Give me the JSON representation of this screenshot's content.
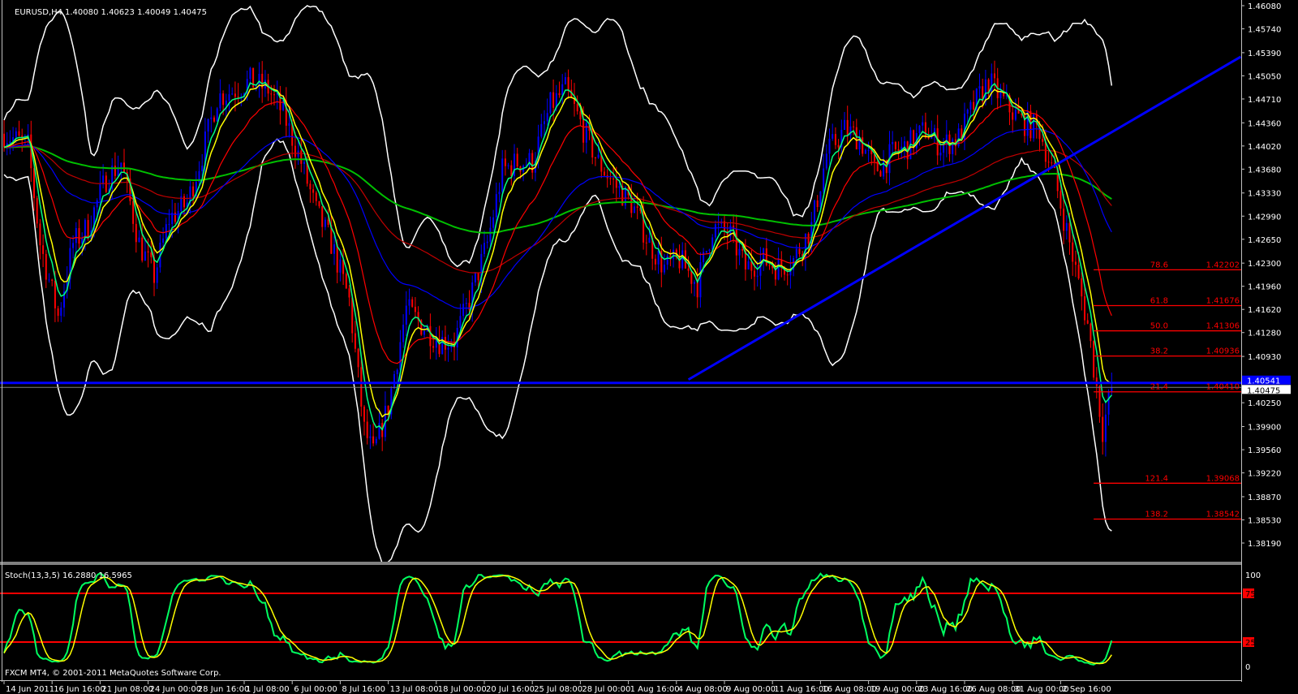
{
  "header": {
    "symbol": "EURUSD,H4",
    "ohlc": "1.40080 1.40623 1.40049 1.40475"
  },
  "stoch_label": "Stoch(13,3,5) 16.2880 16.5965",
  "copyright": "FXCM MT4, © 2001-2011 MetaQuotes Software Corp.",
  "colors": {
    "background": "#000000",
    "bull": "#0000ff",
    "bear": "#ff0000",
    "bands": "#ffffff",
    "ma_fast": "#00ff80",
    "ma_8": "#ffff00",
    "ma_21": "#ff0000",
    "ma_55": "#0000ff",
    "ma_100": "#c00000",
    "ma_200": "#00c000",
    "trendline": "#0000ff",
    "fib": "#ff0000",
    "stoch_main": "#00ff60",
    "stoch_signal": "#ffff00"
  },
  "chart_data": [
    {
      "type": "line",
      "title": "EURUSD,H4",
      "ylabel": "Price",
      "ylim": [
        1.3819,
        1.4608
      ],
      "x_unit": "H4 bar index",
      "xlim": [
        0,
        412
      ],
      "price_ticks": [
        "1.46080",
        "1.45740",
        "1.45390",
        "1.45050",
        "1.44710",
        "1.44360",
        "1.44020",
        "1.43680",
        "1.43330",
        "1.42990",
        "1.42650",
        "1.42300",
        "1.41960",
        "1.41620",
        "1.41280",
        "1.40930",
        "1.40250",
        "1.39900",
        "1.39560",
        "1.39220",
        "1.38870",
        "1.38530",
        "1.38190"
      ],
      "time_ticks": [
        "14 Jun 2011",
        "16 Jun 16:00",
        "21 Jun 08:00",
        "24 Jun 00:00",
        "28 Jun 16:00",
        "1 Jul 08:00",
        "6 Jul 00:00",
        "8 Jul 16:00",
        "13 Jul 08:00",
        "18 Jul 00:00",
        "20 Jul 16:00",
        "25 Jul 08:00",
        "28 Jul 00:00",
        "1 Aug 16:00",
        "4 Aug 08:00",
        "9 Aug 00:00",
        "11 Aug 16:00",
        "16 Aug 08:00",
        "19 Aug 00:00",
        "23 Aug 16:00",
        "26 Aug 08:00",
        "31 Aug 00:00",
        "2 Sep 16:00"
      ],
      "bars_per_time_tick": 16,
      "price_path": [
        [
          0,
          1.442
        ],
        [
          8,
          1.4402
        ],
        [
          12,
          1.4259
        ],
        [
          18,
          1.4152
        ],
        [
          23,
          1.4259
        ],
        [
          28,
          1.4283
        ],
        [
          34,
          1.4354
        ],
        [
          39,
          1.4378
        ],
        [
          45,
          1.4259
        ],
        [
          50,
          1.4211
        ],
        [
          55,
          1.4295
        ],
        [
          61,
          1.4318
        ],
        [
          66,
          1.439
        ],
        [
          71,
          1.4473
        ],
        [
          77,
          1.4485
        ],
        [
          82,
          1.4497
        ],
        [
          88,
          1.4485
        ],
        [
          93,
          1.445
        ],
        [
          99,
          1.4378
        ],
        [
          104,
          1.4306
        ],
        [
          109,
          1.4259
        ],
        [
          115,
          1.4175
        ],
        [
          120,
          1.3985
        ],
        [
          123,
          1.3949
        ],
        [
          128,
          1.402
        ],
        [
          134,
          1.4163
        ],
        [
          139,
          1.414
        ],
        [
          145,
          1.4116
        ],
        [
          150,
          1.4116
        ],
        [
          155,
          1.4175
        ],
        [
          161,
          1.4259
        ],
        [
          166,
          1.4366
        ],
        [
          171,
          1.4378
        ],
        [
          176,
          1.4378
        ],
        [
          182,
          1.4461
        ],
        [
          187,
          1.4485
        ],
        [
          193,
          1.4426
        ],
        [
          198,
          1.4378
        ],
        [
          204,
          1.4342
        ],
        [
          209,
          1.4318
        ],
        [
          215,
          1.4259
        ],
        [
          220,
          1.4223
        ],
        [
          225,
          1.4235
        ],
        [
          231,
          1.4199
        ],
        [
          236,
          1.4283
        ],
        [
          242,
          1.4271
        ],
        [
          247,
          1.4223
        ],
        [
          253,
          1.4235
        ],
        [
          258,
          1.4223
        ],
        [
          263,
          1.4235
        ],
        [
          269,
          1.4283
        ],
        [
          274,
          1.439
        ],
        [
          280,
          1.4426
        ],
        [
          285,
          1.4414
        ],
        [
          290,
          1.4366
        ],
        [
          296,
          1.439
        ],
        [
          301,
          1.4402
        ],
        [
          307,
          1.4426
        ],
        [
          312,
          1.4402
        ],
        [
          318,
          1.4414
        ],
        [
          323,
          1.4461
        ],
        [
          328,
          1.4497
        ],
        [
          334,
          1.4461
        ],
        [
          339,
          1.4438
        ],
        [
          345,
          1.4426
        ],
        [
          350,
          1.4354
        ],
        [
          355,
          1.4259
        ],
        [
          361,
          1.414
        ],
        [
          366,
          1.3985
        ],
        [
          369,
          1.40475
        ]
      ],
      "current_ask": "1.40541",
      "current_bid": "1.40475",
      "trendline": [
        [
          228,
          1.4059
        ],
        [
          412,
          1.4533
        ]
      ],
      "fib_levels": [
        {
          "level": "78.6",
          "price": "1.42202"
        },
        {
          "level": "61.8",
          "price": "1.41676"
        },
        {
          "level": "50.0",
          "price": "1.41306"
        },
        {
          "level": "38.2",
          "price": "1.40936"
        },
        {
          "level": "21.4",
          "price": "1.40410"
        },
        {
          "level": "121.4",
          "price": "1.39068"
        },
        {
          "level": "138.2",
          "price": "1.38542"
        }
      ],
      "fib_start_bar": 363
    },
    {
      "type": "line",
      "title": "Stoch(13,3,5)",
      "ylim": [
        0,
        100
      ],
      "ticks": [
        "100",
        "75",
        "25",
        "0"
      ],
      "levels": [
        75,
        25
      ],
      "main_value": 16.288,
      "signal_value": 16.5965
    }
  ]
}
